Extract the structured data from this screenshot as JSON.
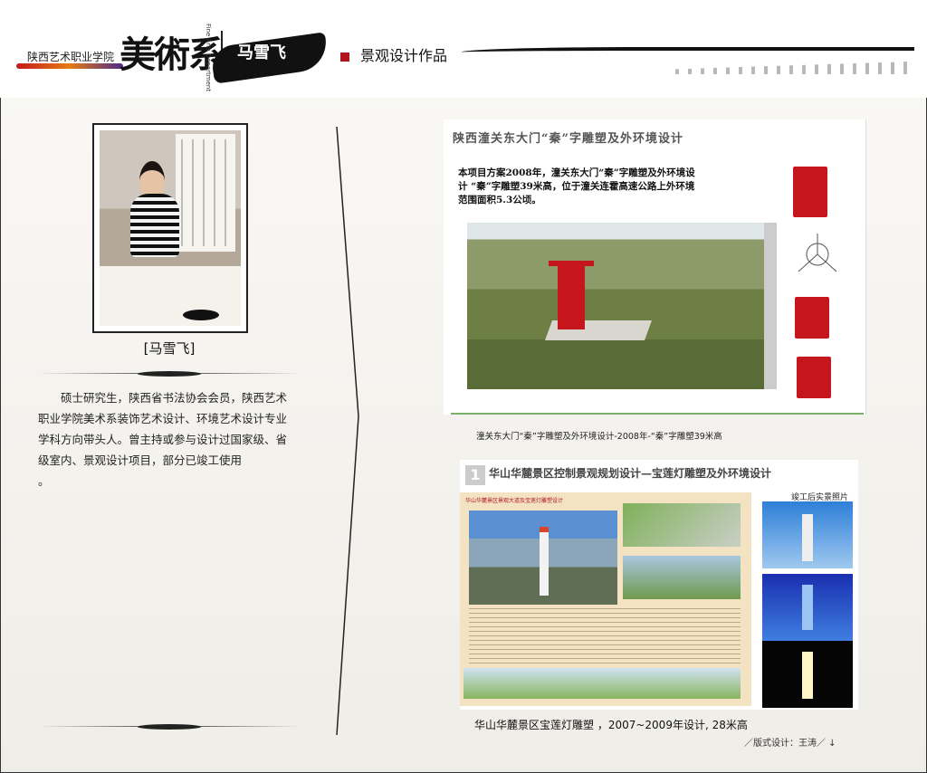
{
  "header": {
    "college": "陕西艺术职业学院",
    "calligraphy": "美術系",
    "dept_en": "Fine Arts Department",
    "designer": "马雪飞",
    "subtitle": "景观设计作品"
  },
  "profile": {
    "name_caption": "[马雪飞]",
    "bio": "硕士研究生，陕西省书法协会会员，陕西艺术职业学院美术系装饰艺术设计、环境艺术设计专业学科方向带头人。曾主持或参与设计过国家级、省级室内、景观设计项目，部分已竣工使用",
    "bio_end": "。"
  },
  "project1": {
    "title": "陕西潼关东大门“秦”字雕塑及外环境设计",
    "description": "本项目方案2008年，潼关东大门“秦”字雕塑及外环境设计 “秦”字雕塑39米高，位于潼关连霍高速公路上外环境范围面积5.3公顷。",
    "caption": "潼关东大门“秦”字雕塑及外环境设计-2008年-“秦”字雕塑39米高"
  },
  "project2": {
    "number": "1",
    "title": "华山华麓景区控制景观规划设计—宝莲灯雕塑及外环境设计",
    "board_title": "华山华麓景区景观大道及宝莲灯雕塑设计",
    "right_label": "竣工后实景照片",
    "caption": "华山华麓景区宝莲灯雕塑  ，2007~2009年设计, 28米高"
  },
  "footer": {
    "credit": "／版式设计：王涛／ ↓"
  },
  "colors": {
    "accent_red": "#c4161c",
    "ink": "#111111",
    "divider_green": "#7ab06a"
  }
}
